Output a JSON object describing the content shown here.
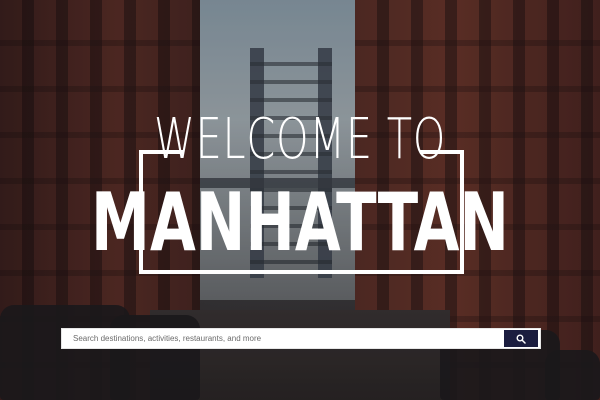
{
  "hero": {
    "title_line1": "WELCOME TO",
    "title_line2": "MANHATTAN"
  },
  "search": {
    "placeholder": "Search destinations, activities, restaurants, and more",
    "value": "",
    "button_icon": "search-icon",
    "button_color": "#1b1d3f"
  },
  "colors": {
    "title_text": "#ffffff",
    "frame": "#ffffff"
  }
}
